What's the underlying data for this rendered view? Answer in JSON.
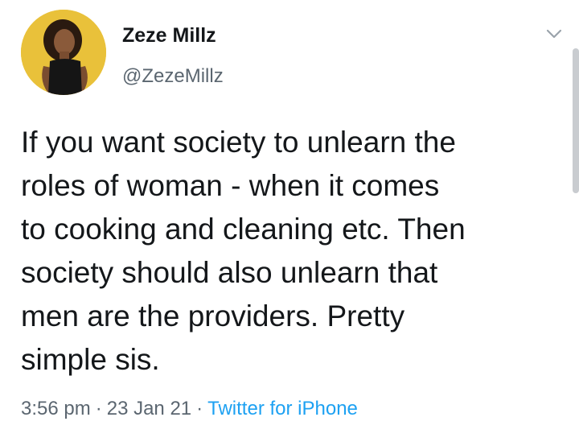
{
  "author": {
    "display_name": "Zeze Millz",
    "handle": "@ZezeMillz"
  },
  "tweet": {
    "lines": [
      "If you want society to unlearn the",
      "roles of woman - when it comes",
      "to cooking and cleaning etc. Then",
      "society should also unlearn that",
      "men are the providers. Pretty",
      "simple sis."
    ],
    "time": "3:56 pm",
    "separator": "·",
    "date": "23 Jan 21",
    "source": "Twitter for iPhone"
  },
  "colors": {
    "text": "#14171a",
    "muted": "#5b6670",
    "link": "#1da1f2",
    "avatar_bg": "#e9c13a"
  },
  "icons": {
    "menu": "chevron-down-icon"
  }
}
